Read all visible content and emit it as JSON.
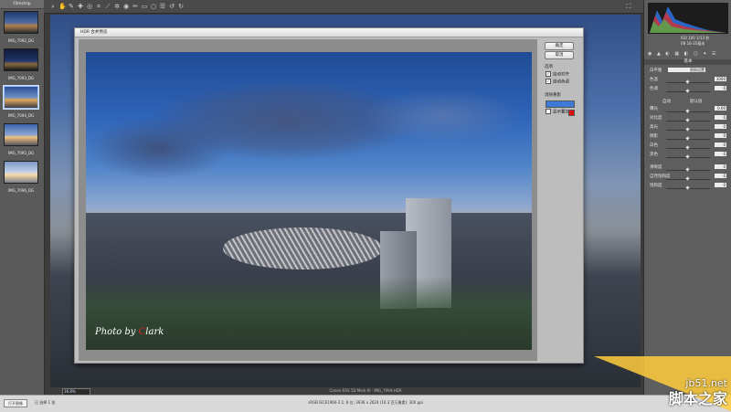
{
  "filmstrip": {
    "title": "Filmstrip",
    "thumbnails": [
      {
        "name": "IMG_7092_DG",
        "stars": "· · · · ·",
        "selected": false
      },
      {
        "name": "IMG_7093_DG",
        "stars": "· · · · ·",
        "selected": false
      },
      {
        "name": "IMG_7094_DG",
        "stars": "· · · · ·",
        "selected": true
      },
      {
        "name": "IMG_7095_DG",
        "stars": "· · · · ·",
        "selected": false
      },
      {
        "name": "IMG_7096_DG",
        "stars": "· · · · ·",
        "selected": false
      }
    ]
  },
  "dialog": {
    "title": "HDR 合并预览",
    "ok_label": "确定",
    "cancel_label": "取消",
    "options_header": "选项",
    "auto_align_label": "自动对齐",
    "auto_tone_label": "自动色调",
    "deghost_label": "消除重影",
    "show_overlay_label": "显示叠加",
    "watermark_prefix": "Photo by ",
    "watermark_logo": "C",
    "watermark_suffix": "lark"
  },
  "right_panel": {
    "camera_info": "ISO 100  1/13 秒",
    "lens_info": "f/8  16-35毫米",
    "panel_title": "基本",
    "profile_label": "白平衡",
    "profile_value": "原照设置",
    "rows": [
      {
        "label": "色温",
        "value": "3000"
      },
      {
        "label": "色调",
        "value": "0"
      },
      {
        "label": "曝光",
        "value": "0.00"
      },
      {
        "label": "对比度",
        "value": "0"
      },
      {
        "label": "高光",
        "value": "0"
      },
      {
        "label": "阴影",
        "value": "0"
      },
      {
        "label": "白色",
        "value": "0"
      },
      {
        "label": "黑色",
        "value": "0"
      },
      {
        "label": "清晰度",
        "value": "0"
      },
      {
        "label": "自然饱和度",
        "value": "0"
      },
      {
        "label": "饱和度",
        "value": "0"
      }
    ],
    "auto_label": "自动",
    "default_label": "默认值"
  },
  "status_bar": {
    "button_label": "打开图像",
    "left_text": "已 选择 1 张",
    "center_text": "sRGB IEC61966-2.1; 8 位; 3936 x 2624 (10.3 百万像素); 300 ppi"
  },
  "canvas": {
    "zoom_value": "16.8%",
    "info_text": "Canon EOS 5D Mark III  ·  IMG_7094-HDR"
  },
  "watermark_site": "jb51.net",
  "watermark_site_cn": "脚本之家"
}
